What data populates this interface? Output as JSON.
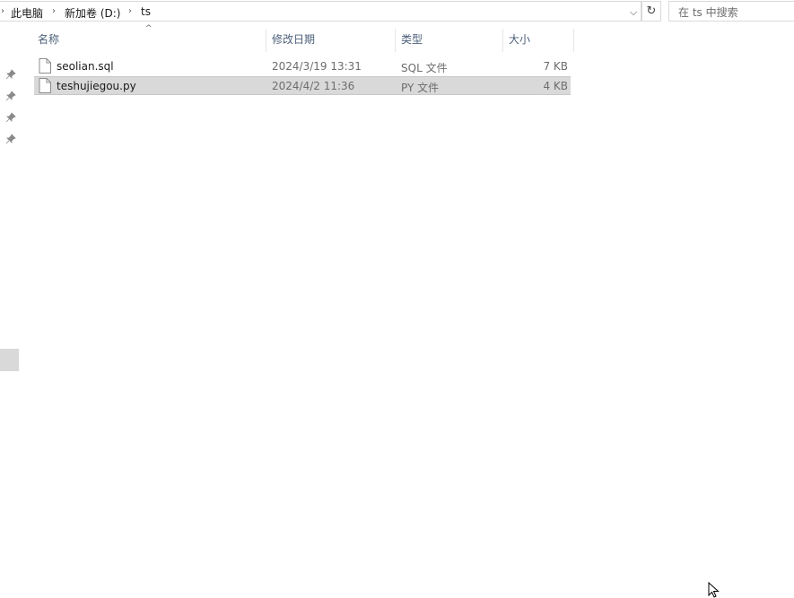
{
  "address": {
    "crumbs": [
      "此电脑",
      "新加卷 (D:)",
      "ts"
    ]
  },
  "search": {
    "placeholder": "在 ts 中搜索"
  },
  "columns": {
    "name": "名称",
    "date": "修改日期",
    "type": "类型",
    "size": "大小"
  },
  "files": [
    {
      "name": "seolian.sql",
      "modified": "2024/3/19 13:31",
      "type": "SQL 文件",
      "size": "7 KB",
      "selected": false
    },
    {
      "name": "teshujiegou.py",
      "modified": "2024/4/2 11:36",
      "type": "PY 文件",
      "size": "4 KB",
      "selected": true
    }
  ],
  "icons": {
    "pin": "pin-icon",
    "file": "document-icon",
    "dropdown": "chevron-down-icon",
    "refresh": "refresh-icon",
    "sort": "sort-ascending-icon",
    "cursor": "mouse-pointer-icon"
  },
  "colors": {
    "header_text": "#4c607a",
    "selection": "#d9d9d9",
    "meta_text": "#6d6d6d"
  }
}
